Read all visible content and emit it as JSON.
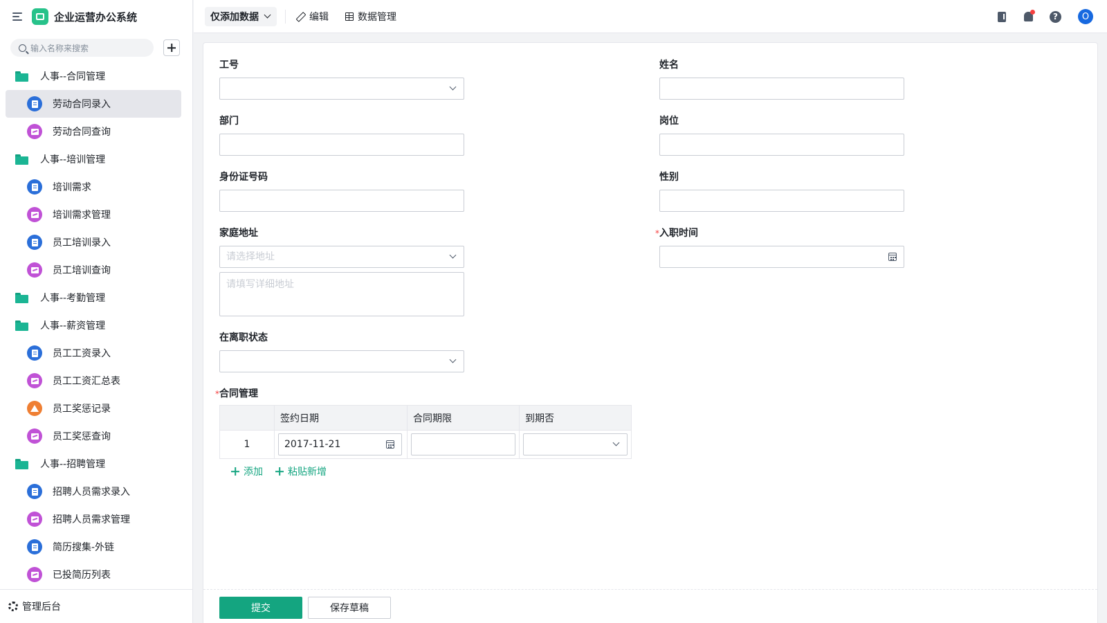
{
  "app": {
    "title": "企业运营办公系统"
  },
  "sidebar": {
    "search_placeholder": "输入名称来搜索",
    "items": [
      {
        "type": "folder",
        "label": "人事--合同管理"
      },
      {
        "type": "page",
        "icon": "form",
        "label": "劳动合同录入",
        "active": true
      },
      {
        "type": "page",
        "icon": "report",
        "label": "劳动合同查询"
      },
      {
        "type": "folder",
        "label": "人事--培训管理"
      },
      {
        "type": "page",
        "icon": "form",
        "label": "培训需求"
      },
      {
        "type": "page",
        "icon": "report",
        "label": "培训需求管理"
      },
      {
        "type": "page",
        "icon": "form",
        "label": "员工培训录入"
      },
      {
        "type": "page",
        "icon": "report",
        "label": "员工培训查询"
      },
      {
        "type": "folder",
        "label": "人事--考勤管理"
      },
      {
        "type": "folder",
        "label": "人事--薪资管理"
      },
      {
        "type": "page",
        "icon": "form",
        "label": "员工工资录入"
      },
      {
        "type": "page",
        "icon": "report",
        "label": "员工工资汇总表"
      },
      {
        "type": "page",
        "icon": "flow",
        "label": "员工奖惩记录"
      },
      {
        "type": "page",
        "icon": "report",
        "label": "员工奖惩查询"
      },
      {
        "type": "folder",
        "label": "人事--招聘管理"
      },
      {
        "type": "page",
        "icon": "form",
        "label": "招聘人员需求录入"
      },
      {
        "type": "page",
        "icon": "report",
        "label": "招聘人员需求管理"
      },
      {
        "type": "page",
        "icon": "form",
        "label": "简历搜集-外链"
      },
      {
        "type": "page",
        "icon": "report",
        "label": "已投简历列表"
      }
    ],
    "footer_label": "管理后台"
  },
  "toolbar": {
    "mode_label": "仅添加数据",
    "edit_label": "编辑",
    "data_manage_label": "数据管理",
    "help_glyph": "?",
    "avatar_initial": "O"
  },
  "form": {
    "employee_id": {
      "label": "工号",
      "value": ""
    },
    "name": {
      "label": "姓名",
      "value": ""
    },
    "department": {
      "label": "部门",
      "value": ""
    },
    "position": {
      "label": "岗位",
      "value": ""
    },
    "id_number": {
      "label": "身份证号码",
      "value": ""
    },
    "gender": {
      "label": "性别",
      "value": ""
    },
    "address": {
      "label": "家庭地址",
      "region_placeholder": "请选择地址",
      "detail_placeholder": "请填写详细地址"
    },
    "hire_date": {
      "label": "入职时间",
      "required_mark": "*",
      "value": ""
    },
    "employment_status": {
      "label": "在离职状态",
      "value": ""
    },
    "contracts": {
      "label": "合同管理",
      "required_mark": "*",
      "columns": [
        "签约日期",
        "合同期限",
        "到期否"
      ],
      "rows": [
        {
          "index": "1",
          "sign_date": "2017-11-21",
          "term": "",
          "expired": ""
        }
      ],
      "add_label": "添加",
      "paste_add_label": "粘贴新增"
    }
  },
  "actions": {
    "submit_label": "提交",
    "draft_label": "保存草稿"
  },
  "colors": {
    "accent": "#14a580",
    "form_icon": "#2b6fd9",
    "report_icon": "#c052d6",
    "flow_icon": "#ef7f33",
    "folder": "#1bb594"
  }
}
